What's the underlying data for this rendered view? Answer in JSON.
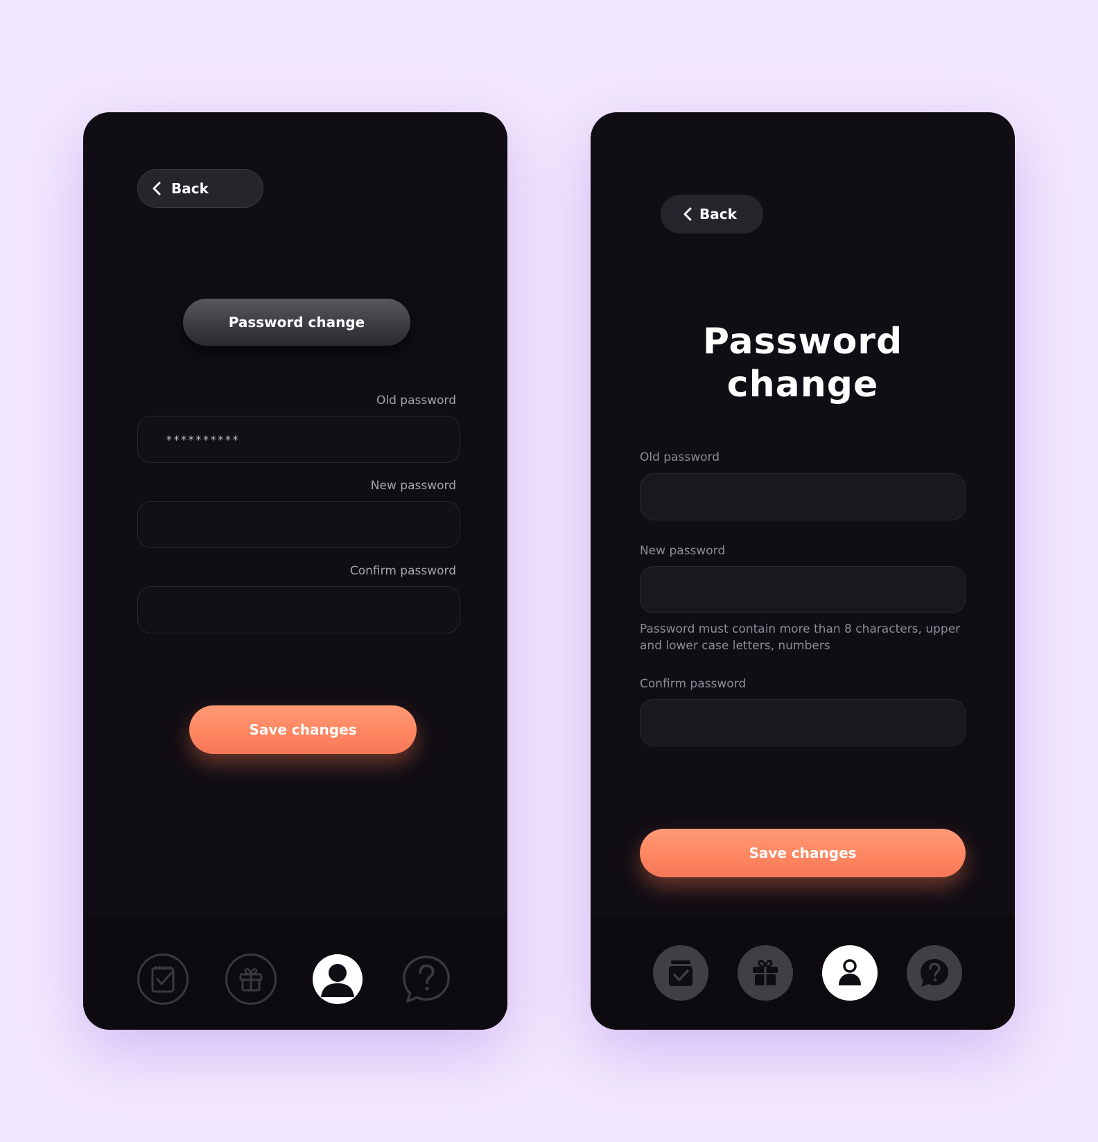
{
  "left_screen": {
    "back_label": "Back",
    "title": "Password change",
    "fields": {
      "old_label": "Old password",
      "old_value": "**********",
      "new_label": "New password",
      "new_value": "",
      "confirm_label": "Confirm password",
      "confirm_value": ""
    },
    "save_label": "Save changes",
    "nav": [
      "tasks-icon",
      "gift-icon",
      "profile-icon",
      "help-icon"
    ],
    "active_nav": "profile-icon"
  },
  "right_screen": {
    "back_label": "Back",
    "title_line1": "Password",
    "title_line2": "change",
    "fields": {
      "old_label": "Old password",
      "old_value": "",
      "new_label": "New password",
      "new_value": "",
      "new_hint": "Password must contain more than 8 characters, upper and lower case letters, numbers",
      "confirm_label": "Confirm password",
      "confirm_value": ""
    },
    "save_label": "Save changes",
    "nav": [
      "tasks-icon",
      "gift-icon",
      "profile-icon",
      "help-icon"
    ],
    "active_nav": "profile-icon"
  },
  "colors": {
    "background": "#f2e8fd",
    "screen": "#100d14",
    "accent": "#ff8a65",
    "field": "#1a181e"
  }
}
